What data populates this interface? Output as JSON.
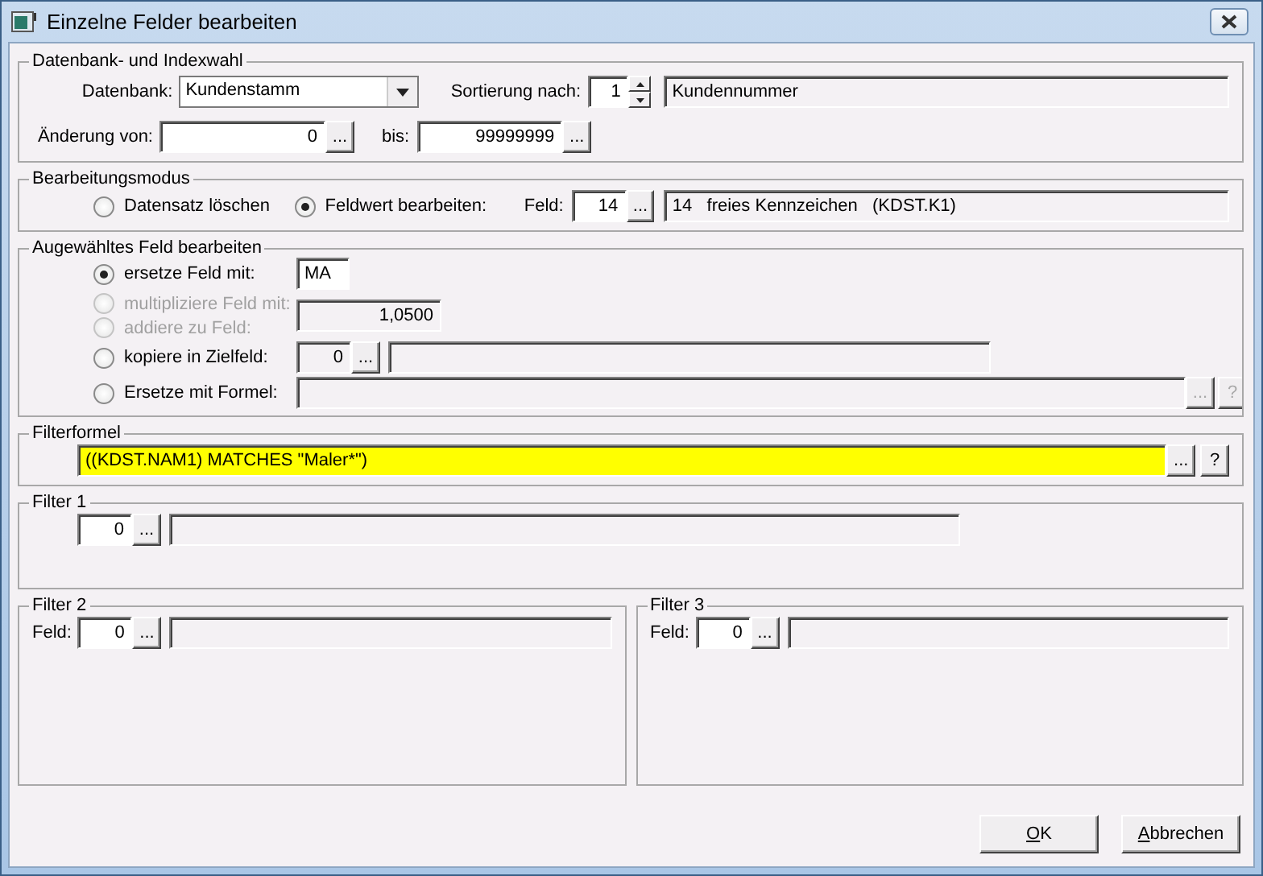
{
  "window": {
    "title": "Einzelne Felder bearbeiten"
  },
  "datenbank_indexwahl": {
    "title": "Datenbank- und Indexwahl",
    "datenbank": {
      "label": "Datenbank:",
      "value": "Kundenstamm"
    },
    "sortierung": {
      "label": "Sortierung nach:",
      "value": "1",
      "description": "Kundennummer"
    },
    "aenderung_von": {
      "label": "Änderung von:",
      "value": "0",
      "button": "..."
    },
    "bis": {
      "label": "bis:",
      "value": "99999999",
      "button": "..."
    }
  },
  "bearbeitungsmodus": {
    "title": "Bearbeitungsmodus",
    "options": [
      {
        "label": "Datensatz löschen",
        "selected": false
      },
      {
        "label": "Feldwert bearbeiten:",
        "selected": true
      }
    ],
    "feld": {
      "label": "Feld:",
      "value": "14",
      "button": "...",
      "description": "14   freies Kennzeichen   (KDST.K1)"
    }
  },
  "ausgewaehltes_feld": {
    "title": "Augewähltes Feld bearbeiten",
    "options": [
      {
        "label": "ersetze Feld mit:",
        "selected": true,
        "disabled": false
      },
      {
        "label": "multipliziere Feld mit:",
        "selected": false,
        "disabled": true
      },
      {
        "label": "addiere zu Feld:",
        "selected": false,
        "disabled": true
      },
      {
        "label": "kopiere in Zielfeld:",
        "selected": false,
        "disabled": false
      },
      {
        "label": "Ersetze mit Formel:",
        "selected": false,
        "disabled": false
      }
    ],
    "ersetze_wert": "MA",
    "faktor": "1,0500",
    "zielfeld": {
      "value": "0",
      "button": "..."
    },
    "formel_buttons": [
      {
        "label": "...",
        "disabled": true
      },
      {
        "label": "?",
        "disabled": true
      }
    ]
  },
  "filterformel": {
    "title": "Filterformel",
    "value": "((KDST.NAM1) MATCHES \"Maler*\")",
    "buttons": [
      {
        "label": "...",
        "disabled": false
      },
      {
        "label": "?",
        "disabled": false
      }
    ]
  },
  "filter_1": {
    "title": "Filter 1",
    "value": "0",
    "button": "..."
  },
  "filter_2": {
    "title": "Filter 2",
    "label": "Feld:",
    "value": "0",
    "button": "..."
  },
  "filter_3": {
    "title": "Filter 3",
    "label": "Feld:",
    "value": "0",
    "button": "..."
  },
  "buttons": [
    {
      "label": "OK",
      "mnemonic_underlined": true
    },
    {
      "label": "Abbrechen",
      "mnemonic_underlined": true
    }
  ]
}
